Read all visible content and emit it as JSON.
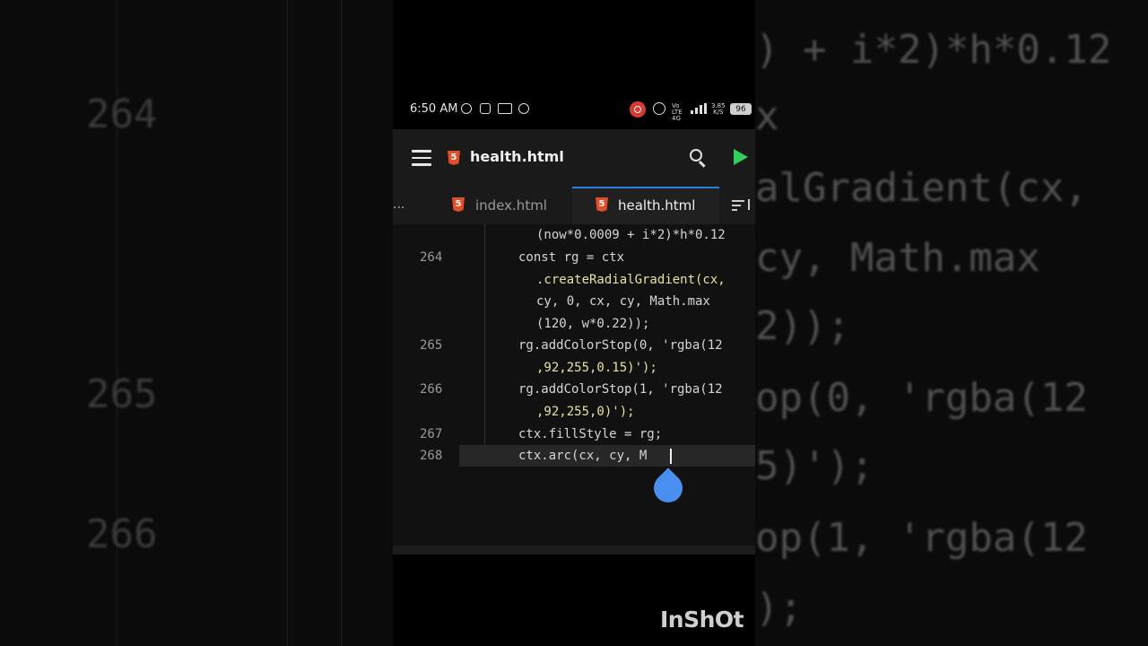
{
  "background": {
    "left_line_numbers": [
      "264",
      "265",
      "266"
    ],
    "right_code_lines": [
      ") + i*2)*h*0.12",
      "x",
      "alGradient(cx,",
      "cy, Math.max",
      "2));",
      "op(0, 'rgba(12",
      "5)');",
      "op(1, 'rgba(12",
      ");"
    ]
  },
  "status_bar": {
    "time": "6:50 AM",
    "network_label": "Vo LTE 4G",
    "speed_value": "3.85",
    "speed_unit": "K/S",
    "battery": "96"
  },
  "app_bar": {
    "title": "health.html"
  },
  "tabs": {
    "more": "...",
    "items": [
      {
        "label": "index.html",
        "active": false
      },
      {
        "label": "health.html",
        "active": true
      }
    ]
  },
  "editor": {
    "line_numbers": [
      "264",
      "265",
      "266",
      "267",
      "268"
    ],
    "lines": [
      "(now*0.0009 + i*2)*h*0.12",
      "const rg = ctx",
      ".createRadialGradient(cx,",
      "cy, 0, cx, cy, Math.max",
      "(120, w*0.22));",
      "rg.addColorStop(0, 'rgba(12",
      ",92,255,0.15)');",
      "rg.addColorStop(1, 'rgba(12",
      ",92,255,0)');",
      "ctx.fillStyle = rg;",
      "ctx.arc(cx, cy, M"
    ]
  },
  "watermark": "InShOt",
  "colors": {
    "accent_tab": "#2f7fe0",
    "run_button": "#2ed15a",
    "html_icon": "#e44d26",
    "record_indicator": "#d83a32",
    "cursor_drop": "#4a8ef0"
  },
  "icons": [
    "menu-icon",
    "html5-icon",
    "search-icon",
    "run-icon",
    "sort-icon",
    "record-icon",
    "alarm-icon",
    "signal-icon"
  ]
}
